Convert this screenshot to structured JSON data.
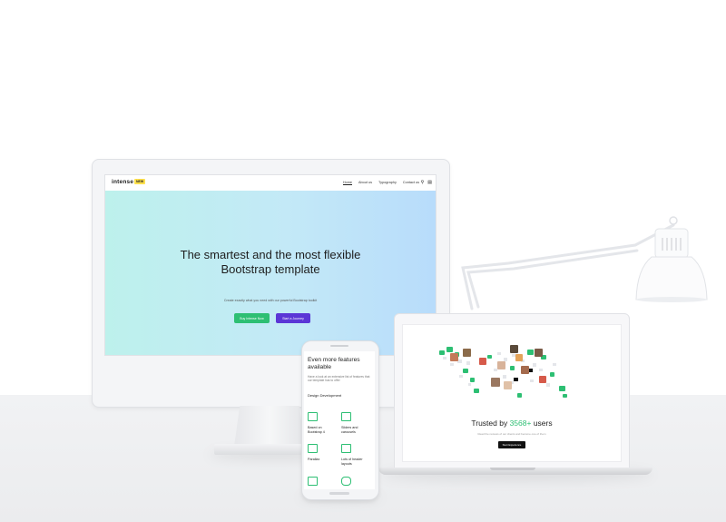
{
  "colors": {
    "accent_green": "#2dbf73",
    "accent_purple": "#5b36d6",
    "badge_yellow": "#ffe14d"
  },
  "monitor": {
    "logo": "intense",
    "badge": "NEW",
    "nav": [
      "Home",
      "About us",
      "Typography",
      "Contact us"
    ],
    "nav_icons": [
      "search-icon",
      "cart-icon"
    ],
    "hero_title": "The smartest and the most flexible Bootstrap template",
    "hero_subtitle": "Create exactly what you need with our powerful Bootstrap toolkit",
    "buttons": {
      "primary": "Buy Intense Now",
      "secondary": "Start a Journey"
    }
  },
  "laptop": {
    "title_prefix": "Trusted by ",
    "title_highlight": "3568+",
    "title_suffix": " users",
    "subtitle": "Read the reviews of our clients and become one of them",
    "button": "Start Experience"
  },
  "phone": {
    "title": "Even more features available",
    "description": "Have a look at an extensive list of features that our template has to offer",
    "section": "Design Development",
    "features": [
      {
        "label": "Based on Bootstrap 4",
        "icon": "bootstrap-icon"
      },
      {
        "label": "Sliders and carousels",
        "icon": "slider-icon"
      },
      {
        "label": "Parallax",
        "icon": "parallax-icon"
      },
      {
        "label": "Lots of header layouts",
        "icon": "header-icon"
      }
    ]
  }
}
